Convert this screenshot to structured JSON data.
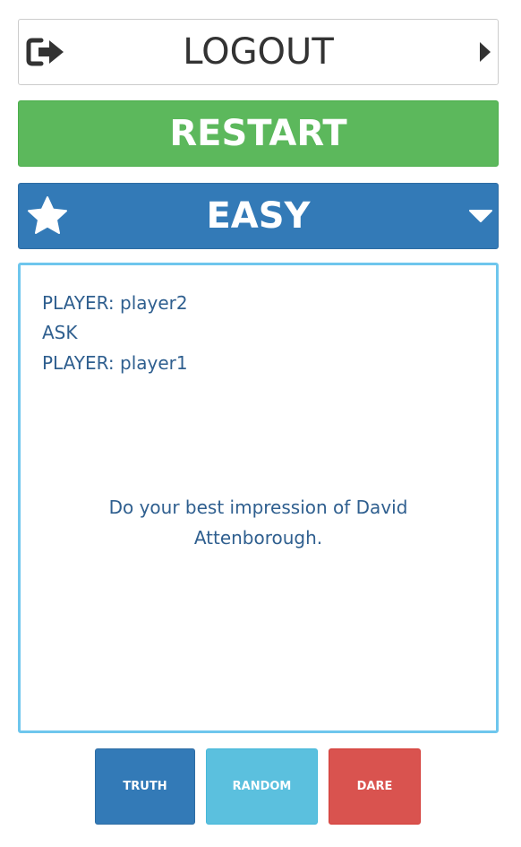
{
  "header": {
    "logout_label": "LOGOUT",
    "logout_icon": "sign-out-icon",
    "logout_arrow_icon": "caret-right-icon"
  },
  "controls": {
    "restart_label": "RESTART",
    "level_label": "EASY",
    "level_icon": "star-icon",
    "level_dropdown_icon": "caret-down-icon"
  },
  "game": {
    "player_line": "PLAYER: player2",
    "action_line": "ASK",
    "target_line": "PLAYER: player1",
    "challenge_text": "Do your best impression of David Attenborough."
  },
  "actions": {
    "truth_label": "TRUTH",
    "random_label": "RANDOM",
    "dare_label": "DARE"
  },
  "colors": {
    "success": "#5cb85c",
    "primary": "#337ab7",
    "info": "#5bc0de",
    "danger": "#d9534f",
    "panel_border": "#6ec6ed",
    "text": "#2f5f8f"
  }
}
